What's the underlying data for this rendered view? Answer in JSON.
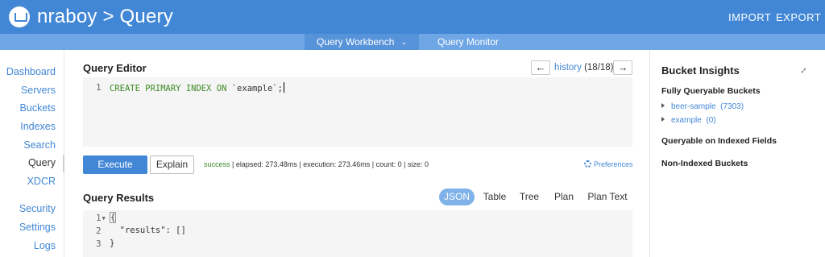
{
  "header": {
    "title": "nraboy > Query",
    "import_label": "IMPORT",
    "export_label": "EXPORT",
    "brand_color": "#4287d6"
  },
  "subnav": {
    "tabs": [
      {
        "label": "Query Workbench",
        "active": true
      },
      {
        "label": "Query Monitor",
        "active": false
      }
    ]
  },
  "sidebar": {
    "items": [
      {
        "label": "Dashboard"
      },
      {
        "label": "Servers"
      },
      {
        "label": "Buckets"
      },
      {
        "label": "Indexes"
      },
      {
        "label": "Search"
      },
      {
        "label": "Query",
        "active": true
      },
      {
        "label": "XDCR"
      },
      {
        "label": "Security"
      },
      {
        "label": "Settings"
      },
      {
        "label": "Logs"
      }
    ]
  },
  "editor": {
    "title": "Query Editor",
    "history_link": "history",
    "history_count": "(18/18)",
    "prev_icon": "arrow-left-icon",
    "next_icon": "arrow-right-icon",
    "line_number": "1",
    "code_keywords": "CREATE PRIMARY INDEX ON",
    "code_rest": " `example`;"
  },
  "actions": {
    "execute_label": "Execute",
    "explain_label": "Explain",
    "status_success": "success",
    "status_details": " | elapsed: 273.48ms | execution: 273.46ms | count: 0 | size: 0",
    "preferences_label": "Preferences",
    "preferences_icon": "gear-icon"
  },
  "results": {
    "title": "Query Results",
    "tabs": [
      {
        "label": "JSON",
        "active": true
      },
      {
        "label": "Table"
      },
      {
        "label": "Tree"
      },
      {
        "label": "Plan"
      },
      {
        "label": "Plan Text"
      }
    ],
    "lines": [
      {
        "num": "1",
        "text": "{"
      },
      {
        "num": "2",
        "text": "  \"results\": []"
      },
      {
        "num": "3",
        "text": "}"
      }
    ]
  },
  "insights": {
    "title": "Bucket Insights",
    "expand_icon": "expand-icon",
    "fully_queryable_label": "Fully Queryable Buckets",
    "buckets": [
      {
        "name": "beer-sample",
        "count": "(7303)"
      },
      {
        "name": "example",
        "count": "(0)"
      }
    ],
    "indexed_fields_label": "Queryable on Indexed Fields",
    "non_indexed_label": "Non-Indexed Buckets"
  }
}
